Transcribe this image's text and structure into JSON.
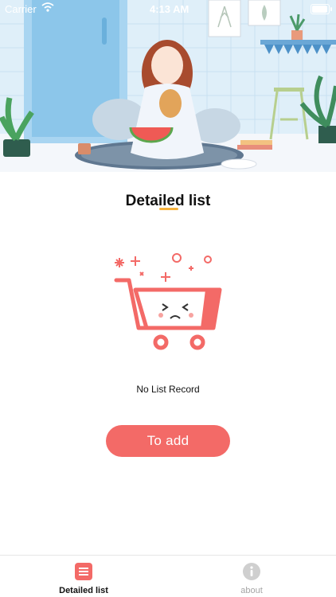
{
  "status_bar": {
    "carrier": "Carrier",
    "time": "4:13 AM"
  },
  "header": {
    "title": "Detailed list"
  },
  "empty_state": {
    "message": "No List Record"
  },
  "actions": {
    "add_label": "To add"
  },
  "tab_bar": {
    "items": [
      {
        "label": "Detailed list",
        "icon": "list-icon",
        "active": true
      },
      {
        "label": "about",
        "icon": "info-icon",
        "active": false
      }
    ]
  },
  "colors": {
    "accent": "#f36a67",
    "title_underline": "#f6b23c",
    "inactive_tab": "#a5a5a5"
  }
}
